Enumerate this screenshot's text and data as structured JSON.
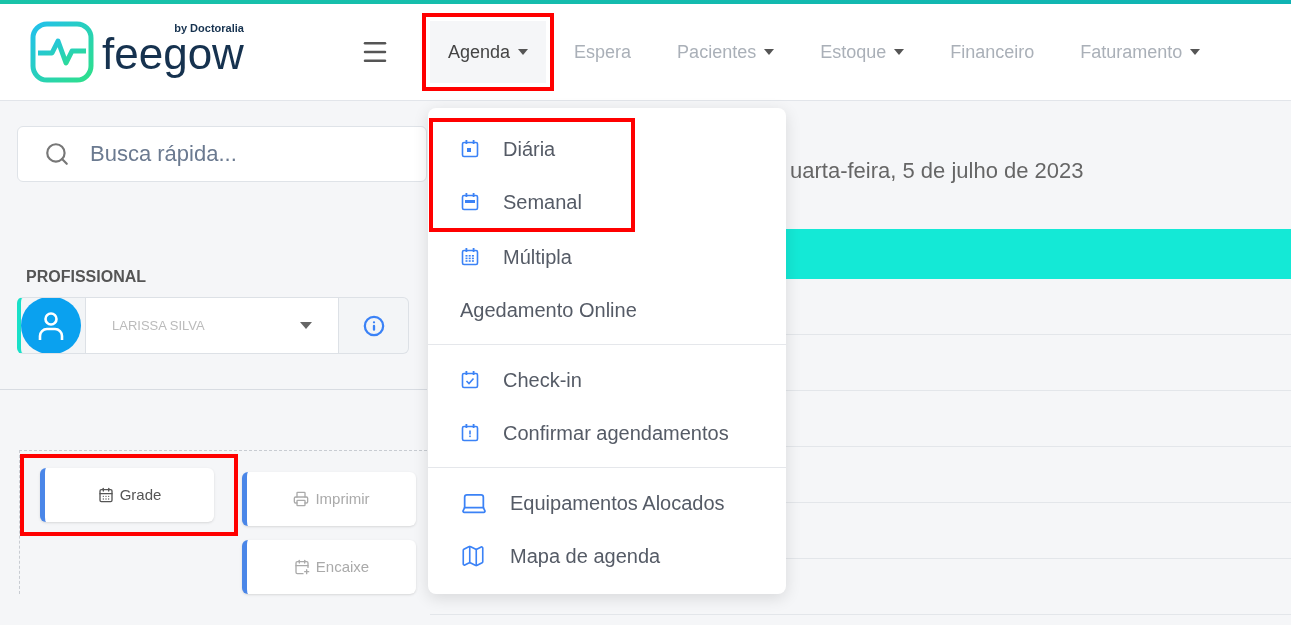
{
  "logo": {
    "name": "feegow",
    "byline": "by Doctoralia"
  },
  "nav": [
    {
      "label": "Agenda",
      "caret": true,
      "selected": true,
      "highlighted": true
    },
    {
      "label": "Espera",
      "caret": false,
      "selected": false,
      "highlighted": false
    },
    {
      "label": "Pacientes",
      "caret": true,
      "selected": false,
      "highlighted": false
    },
    {
      "label": "Estoque",
      "caret": true,
      "selected": false,
      "highlighted": false
    },
    {
      "label": "Financeiro",
      "caret": false,
      "selected": false,
      "highlighted": false
    },
    {
      "label": "Faturamento",
      "caret": true,
      "selected": false,
      "highlighted": false
    }
  ],
  "search": {
    "placeholder": "Busca rápida..."
  },
  "professional": {
    "label": "PROFISSIONAL",
    "value": "LARISSA SILVA"
  },
  "view_buttons": [
    {
      "label": "Grade",
      "kind": "grid",
      "highlighted": true
    },
    {
      "label": "Imprimir",
      "kind": "print",
      "highlighted": false
    },
    {
      "label": "Encaixe",
      "kind": "fit",
      "highlighted": false
    }
  ],
  "date": "uarta-feira, 5 de julho de 2023",
  "agenda_menu": [
    [
      {
        "label": "Diária",
        "kind": "day",
        "highlighted": true
      },
      {
        "label": "Semanal",
        "kind": "week",
        "highlighted": true
      },
      {
        "label": "Múltipla",
        "kind": "multi",
        "highlighted": false
      },
      {
        "label": "Agedamento Online",
        "kind": "plain",
        "highlighted": false
      }
    ],
    [
      {
        "label": "Check-in",
        "kind": "check",
        "highlighted": false
      },
      {
        "label": "Confirmar agendamentos",
        "kind": "alert",
        "highlighted": false
      }
    ],
    [
      {
        "label": "Equipamentos Alocados",
        "kind": "laptop",
        "highlighted": false
      },
      {
        "label": "Mapa de agenda",
        "kind": "map",
        "highlighted": false
      }
    ]
  ]
}
